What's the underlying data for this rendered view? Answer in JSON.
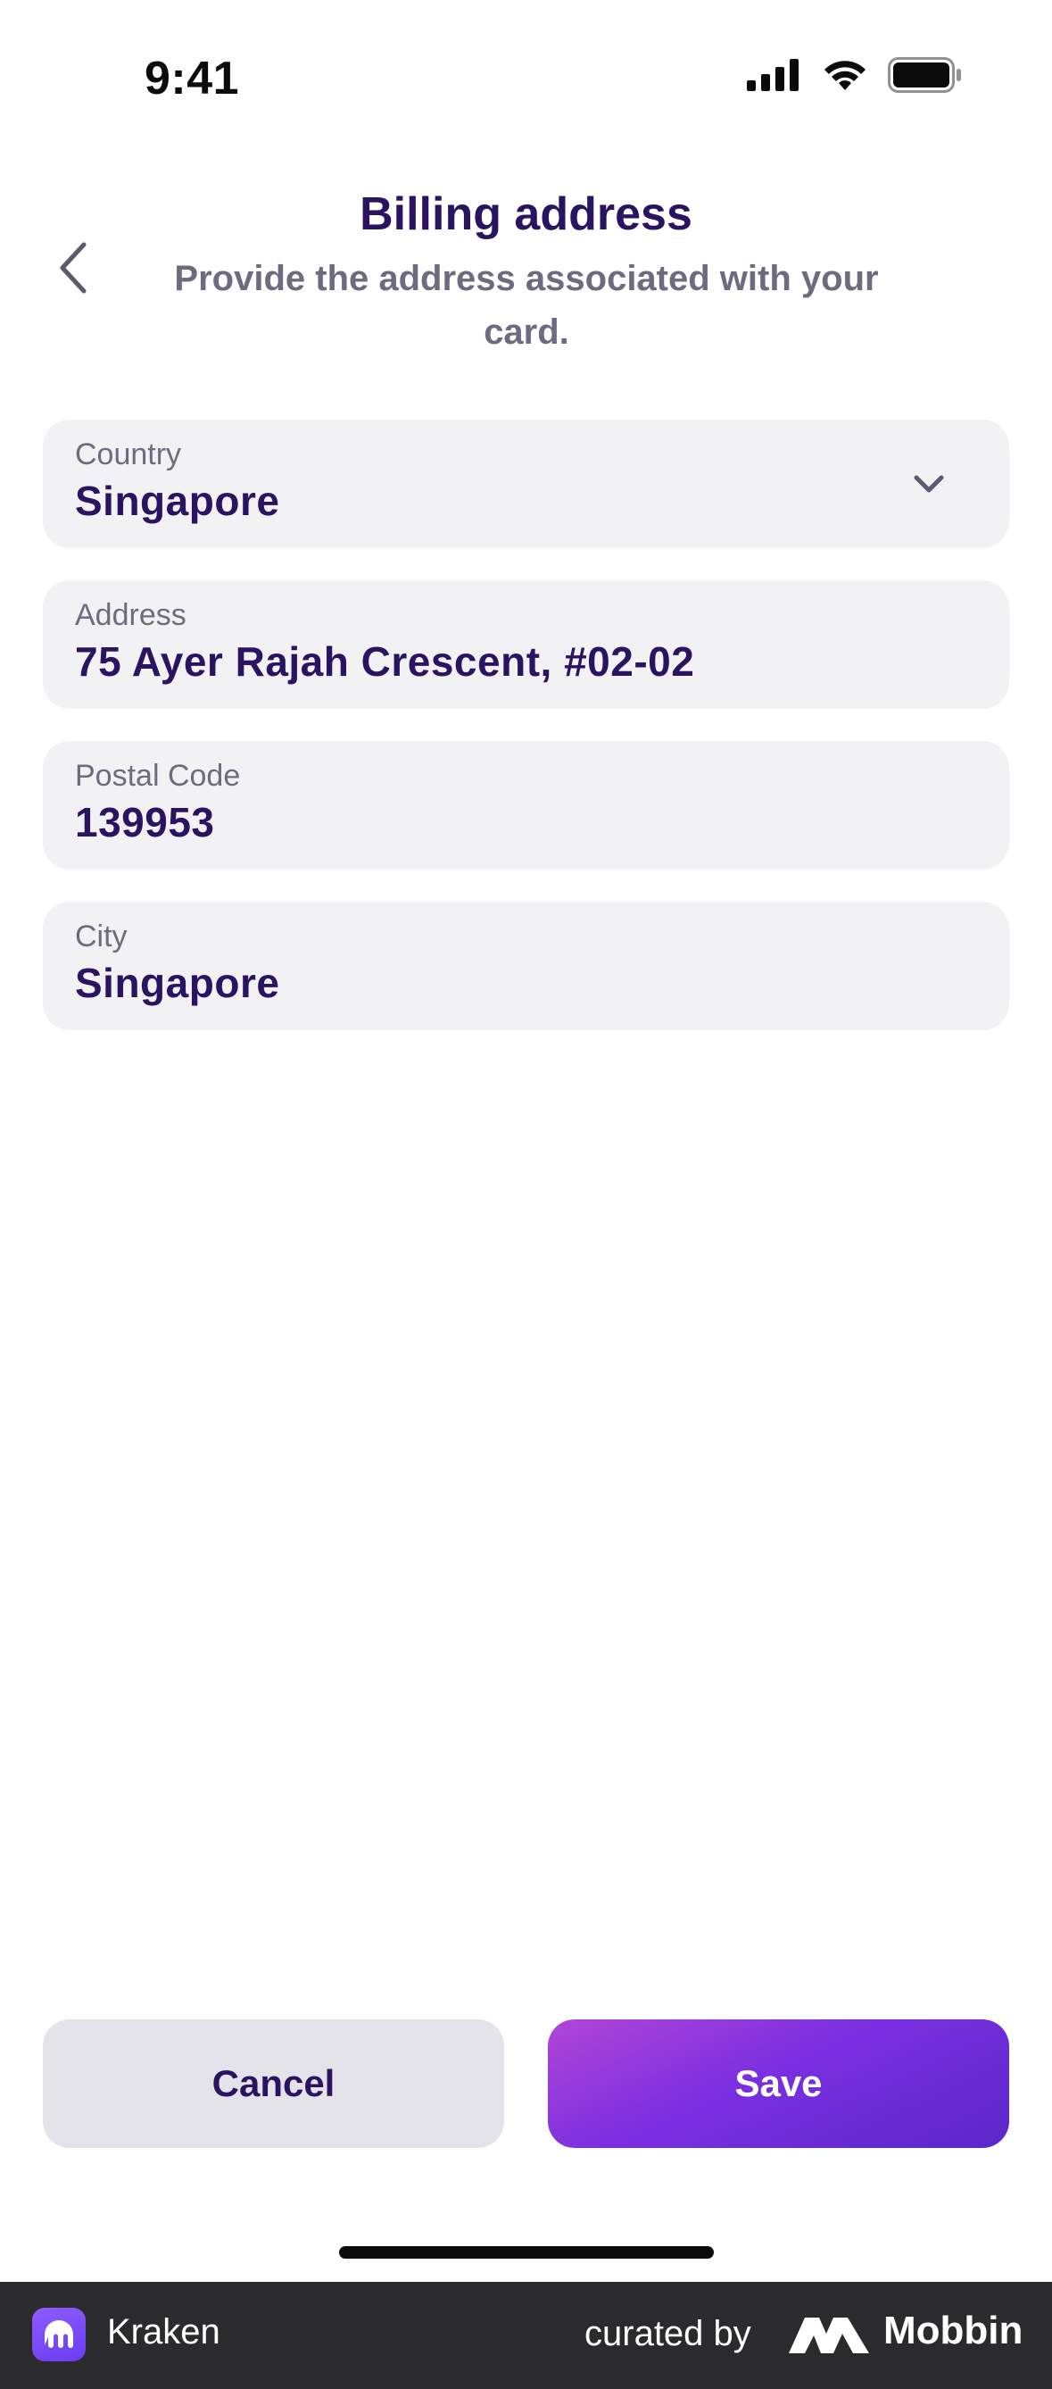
{
  "status_bar": {
    "time": "9:41"
  },
  "header": {
    "back_icon": "chevron-left-icon",
    "title": "Billing address",
    "subtitle": "Provide the address associated with your card."
  },
  "form": {
    "country": {
      "label": "Country",
      "value": "Singapore",
      "icon": "chevron-down-icon"
    },
    "address": {
      "label": "Address",
      "value": "75 Ayer Rajah Crescent, #02-02"
    },
    "postal_code": {
      "label": "Postal Code",
      "value": "139953"
    },
    "city": {
      "label": "City",
      "value": "Singapore"
    }
  },
  "actions": {
    "cancel_label": "Cancel",
    "save_label": "Save"
  },
  "footer": {
    "app_name": "Kraken",
    "curated_by": "curated by",
    "brand": "Mobbin"
  },
  "colors": {
    "primary_text": "#2a1461",
    "secondary_text": "#6e6b80",
    "field_bg": "#f2f2f4",
    "accent_start": "#b146d6",
    "accent_end": "#5b27c9"
  }
}
